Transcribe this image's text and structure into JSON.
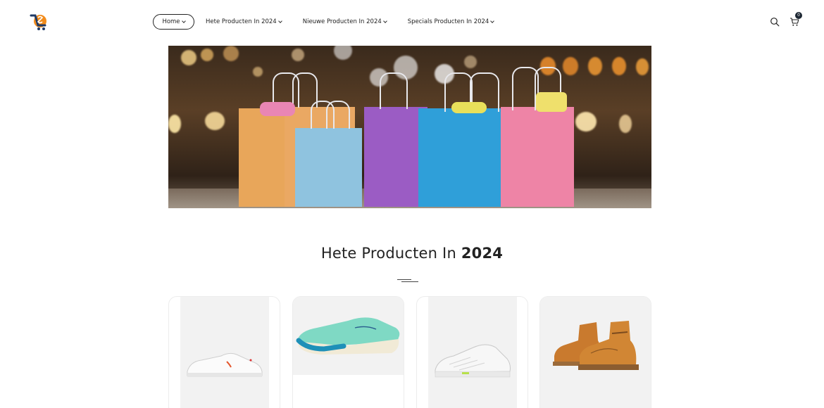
{
  "nav": {
    "items": [
      {
        "label": "Home"
      },
      {
        "label": "Hete Producten In 2024"
      },
      {
        "label": "Nieuwe Producten In 2024"
      },
      {
        "label": "Specials Producten In 2024"
      }
    ]
  },
  "header": {
    "cart_count": "0",
    "logo_icon": "shopping-cart-logo",
    "search_icon": "search-icon",
    "cart_icon": "cart-icon"
  },
  "banner": {
    "image": "colorful shopping bags"
  },
  "section": {
    "title_regular": "Hete Producten In",
    "title_bold": "2024"
  },
  "products": [
    {
      "image": "white sneaker"
    },
    {
      "image": "mint green running shoe"
    },
    {
      "image": "white air max sneaker"
    },
    {
      "image": "brown high-top boot"
    }
  ],
  "colors": {
    "accent": "#1d2733",
    "logo_orange": "#f28c1c",
    "logo_navy": "#1f3a66"
  }
}
